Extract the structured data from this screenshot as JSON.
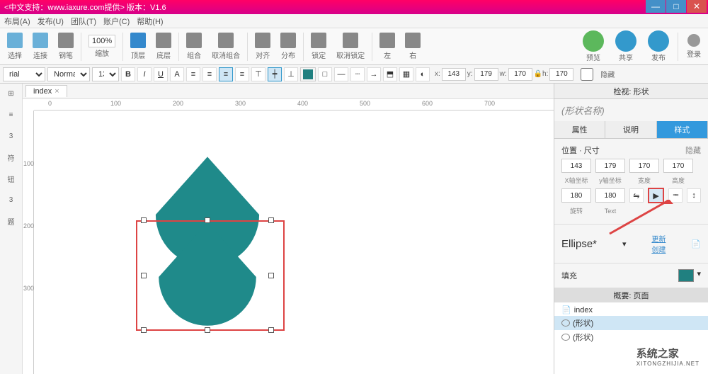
{
  "title": "<中文支持：www.iaxure.com提供> 版本：V1.6",
  "menu": [
    "布局(A)",
    "发布(U)",
    "团队(T)",
    "账户(C)",
    "帮助(H)"
  ],
  "toolbar": {
    "items": [
      "选择",
      "连接",
      "钢笔",
      "缩放",
      "顶层",
      "底层",
      "组合",
      "取消组合",
      "对齐",
      "分布",
      "锁定",
      "取消锁定",
      "左",
      "右"
    ],
    "zoom": "100%",
    "right": [
      "预览",
      "共享",
      "发布"
    ],
    "login": "登录"
  },
  "format": {
    "font": "rial",
    "weight": "Normal",
    "size": "13",
    "x": "143",
    "y": "179",
    "w": "170",
    "h": "170",
    "hidden": "隐藏"
  },
  "tab": {
    "name": "index"
  },
  "ruler_h": [
    "0",
    "100",
    "200",
    "300",
    "400",
    "500",
    "600",
    "700"
  ],
  "ruler_v": [
    "100",
    "200",
    "300"
  ],
  "inspector": {
    "title": "检视: 形状",
    "name": "(形状名称)",
    "tabs": [
      "属性",
      "说明",
      "样式"
    ],
    "section_pos": "位置 · 尺寸",
    "hide": "隐藏",
    "x": "143",
    "y": "179",
    "w": "170",
    "h": "170",
    "xl": "X轴坐标",
    "yl": "y轴坐标",
    "wl": "宽度",
    "hl": "高度",
    "rot": "180",
    "txt": "180",
    "rotl": "旋转",
    "txtl": "Text",
    "ellipse": "Ellipse*",
    "update": "更新",
    "create": "创建",
    "fill": "填充"
  },
  "outline": {
    "title": "概要: 页面",
    "items": [
      "index",
      "(形状)",
      "(形状)"
    ]
  },
  "left": [
    "3",
    "符",
    "钮",
    "3",
    "题"
  ],
  "watermark": {
    "cn": "系统之家",
    "en": "XITONGZHIJIA.NET"
  }
}
